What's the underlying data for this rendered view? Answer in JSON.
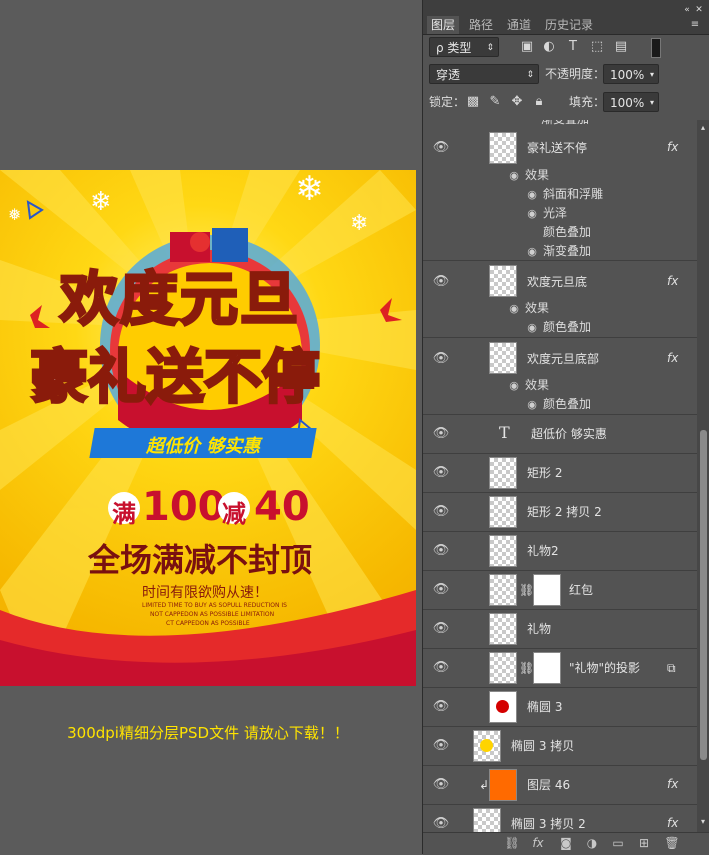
{
  "poster": {
    "title_line1": "欢度元旦",
    "title_line2": "豪礼送不停",
    "ribbon": "超低价 够实惠",
    "promo_full": "满",
    "promo_full_amount": "100",
    "promo_minus": "减",
    "promo_minus_amount": "40",
    "headline": "全场满减不封顶",
    "subline": "时间有限欲购从速！",
    "fine1": "LIMITED TIME TO BUY AS SOPULL REDUCTION IS",
    "fine2": "NOT CAPPEDON AS POSSIBLE LIMITATION",
    "fine3": "CT CAPPEDON AS POSSIBLE",
    "colors": {
      "bg": "#ffd400",
      "title": "#ffd200",
      "red": "#c8102e",
      "dark": "#7a1010"
    }
  },
  "caption": "300dpi精细分层PSD文件 请放心下载！！",
  "panel": {
    "tabs": [
      "图层",
      "路径",
      "通道",
      "历史记录"
    ],
    "active_tab": "图层",
    "filter_label": "ρ 类型",
    "blend_mode": "穿透",
    "opacity_label": "不透明度：",
    "opacity_value": "100%",
    "lock_label": "锁定：",
    "fill_label": "填充：",
    "fill_value": "100%",
    "cut_item": "渐变叠加",
    "layers": [
      {
        "name": "豪礼送不停",
        "fx": "fx",
        "effects_label": "效果",
        "effects": [
          "斜面和浮雕",
          "光泽",
          "颜色叠加",
          "渐变叠加"
        ]
      },
      {
        "name": "欢度元旦底",
        "fx": "fx",
        "effects_label": "效果",
        "effects": [
          "颜色叠加"
        ]
      },
      {
        "name": "欢度元旦底部",
        "fx": "fx",
        "effects_label": "效果",
        "effects": [
          "颜色叠加"
        ]
      },
      {
        "name": "超低价 够实惠",
        "type_icon": "T"
      },
      {
        "name": "矩形 2"
      },
      {
        "name": "矩形 2 拷贝 2"
      },
      {
        "name": "礼物2"
      },
      {
        "name": "红包"
      },
      {
        "name": "礼物"
      },
      {
        "name": "\"礼物\"的投影"
      },
      {
        "name": "椭圆 3"
      },
      {
        "name": "椭圆 3 拷贝"
      },
      {
        "name": "图层 46",
        "fx": "fx"
      },
      {
        "name": "椭圆 3 拷贝 2",
        "fx": "fx"
      }
    ]
  }
}
